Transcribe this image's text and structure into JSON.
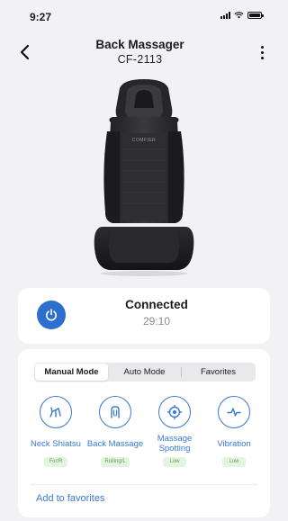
{
  "status_bar": {
    "time": "9:27"
  },
  "header": {
    "title": "Back Massager",
    "subtitle": "CF-2113"
  },
  "product": {
    "brand_text": "COMFIER"
  },
  "connection": {
    "status": "Connected",
    "time": "29:10",
    "accent_color": "#2c6fcf"
  },
  "tabs": [
    {
      "label": "Manual Mode",
      "active": true
    },
    {
      "label": "Auto Mode",
      "active": false
    },
    {
      "label": "Favorites",
      "active": false
    }
  ],
  "features": [
    {
      "label": "Neck Shiatsu",
      "badge": "For/R",
      "icon": "neck-shiatsu-icon"
    },
    {
      "label": "Back Massage",
      "badge": "Rolling/L",
      "icon": "back-massage-icon"
    },
    {
      "label": "Massage Spotting",
      "badge": "Low",
      "icon": "massage-spotting-icon"
    },
    {
      "label": "Vibration",
      "badge": "Low",
      "icon": "vibration-icon"
    }
  ],
  "favorites": {
    "add_label": "Add to favorites"
  },
  "colors": {
    "accent": "#3a78d6",
    "badge_bg": "#e5f4e0",
    "badge_text": "#5ea24a",
    "background": "#f2f2f4"
  }
}
